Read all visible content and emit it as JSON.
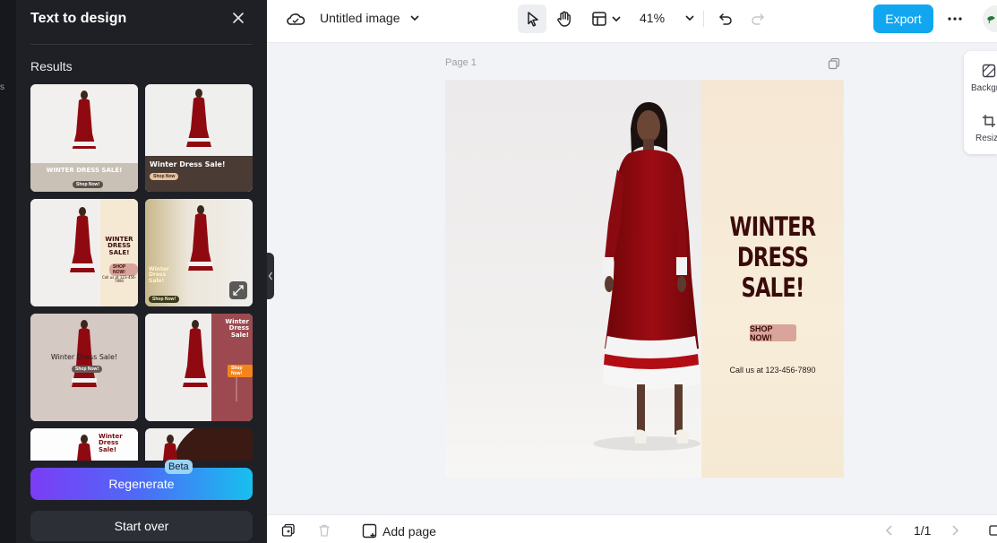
{
  "left_strip": {
    "partial_char": "s"
  },
  "panel": {
    "title": "Text to design",
    "results_label": "Results",
    "thumbnails": [
      {
        "headline": "WINTER DRESS SALE!",
        "button": "Shop Now!"
      },
      {
        "headline": "Winter Dress Sale!",
        "button": "Shop Now"
      },
      {
        "headline": "WINTER DRESS SALE!",
        "button": "SHOP NOW!",
        "footer": "Call us at 123-456-7890"
      },
      {
        "headline": "Winter Dress Sale!",
        "button": "Shop Now!"
      },
      {
        "headline": "Winter Dress Sale!",
        "button": "Shop Now!"
      },
      {
        "headline": "Winter Dress Sale!",
        "button": "Shop Now!"
      },
      {
        "headline": "Winter Dress Sale!"
      },
      {
        "headline": ""
      }
    ],
    "regenerate_label": "Regenerate",
    "beta_label": "Beta",
    "start_over_label": "Start over"
  },
  "toolbar": {
    "title": "Untitled image",
    "zoom": "41%",
    "export_label": "Export"
  },
  "canvas": {
    "page_label": "Page 1",
    "headline_line1": "WINTER",
    "headline_line2": "DRESS",
    "headline_line3": "SALE!",
    "cta": "SHOP NOW!",
    "call": "Call us at 123-456-7890"
  },
  "right_panel": {
    "background_label": "Backgr",
    "resize_label": "Resiz"
  },
  "bottom": {
    "add_page": "Add page",
    "page_count": "1/1"
  },
  "colors": {
    "panel_bg": "#1e2026",
    "export_blue": "#10a7f0",
    "dress_red": "#8f0a10",
    "headline": "#3a0b0b",
    "cta_bg": "#d9a59a"
  }
}
